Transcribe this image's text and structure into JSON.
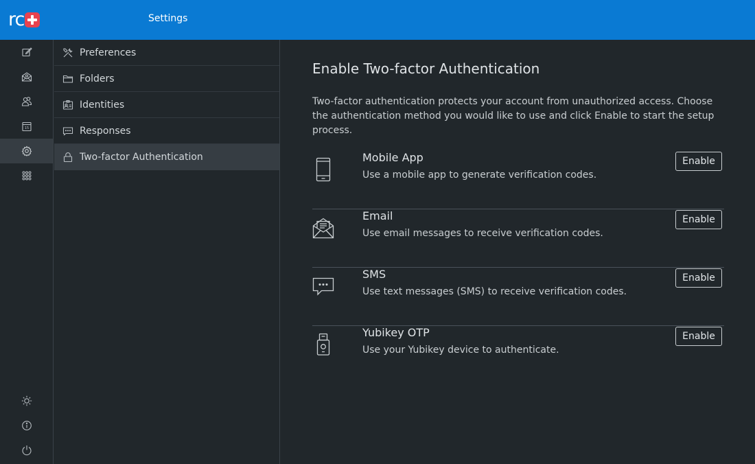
{
  "app": {
    "logo_text": "rc",
    "title": "Settings"
  },
  "taskmenu": {
    "items": [
      {
        "icon": "compose-icon",
        "selected": false
      },
      {
        "icon": "mail-icon",
        "selected": false
      },
      {
        "icon": "contacts-icon",
        "selected": false
      },
      {
        "icon": "calendar-icon",
        "selected": false
      },
      {
        "icon": "settings-icon",
        "selected": true
      },
      {
        "icon": "apps-icon",
        "selected": false
      }
    ],
    "bottom": [
      {
        "icon": "theme-icon"
      },
      {
        "icon": "about-icon"
      },
      {
        "icon": "logout-icon"
      }
    ]
  },
  "settings_nav": {
    "items": [
      {
        "label": "Preferences",
        "icon": "preferences-icon"
      },
      {
        "label": "Folders",
        "icon": "folder-icon"
      },
      {
        "label": "Identities",
        "icon": "identity-icon"
      },
      {
        "label": "Responses",
        "icon": "responses-icon"
      },
      {
        "label": "Two-factor Authentication",
        "icon": "lock-icon",
        "selected": true
      }
    ]
  },
  "main": {
    "heading": "Enable Two-factor Authentication",
    "intro": "Two-factor authentication protects your account from unauthorized access. Choose the authentication method you would like to use and click Enable to start the setup process.",
    "methods": [
      {
        "title": "Mobile App",
        "description": "Use a mobile app to generate verification codes.",
        "button": "Enable",
        "icon": "mobile-icon"
      },
      {
        "title": "Email",
        "description": "Use email messages to receive verification codes.",
        "button": "Enable",
        "icon": "email-icon"
      },
      {
        "title": "SMS",
        "description": "Use text messages (SMS) to receive verification codes.",
        "button": "Enable",
        "icon": "sms-icon"
      },
      {
        "title": "Yubikey OTP",
        "description": "Use your Yubikey device to authenticate.",
        "button": "Enable",
        "icon": "yubikey-icon"
      }
    ]
  },
  "colors": {
    "topbar": "#0a7ad3",
    "background": "#21272b",
    "logo_accent": "#e9424f",
    "selected_bg": "#363d43"
  }
}
